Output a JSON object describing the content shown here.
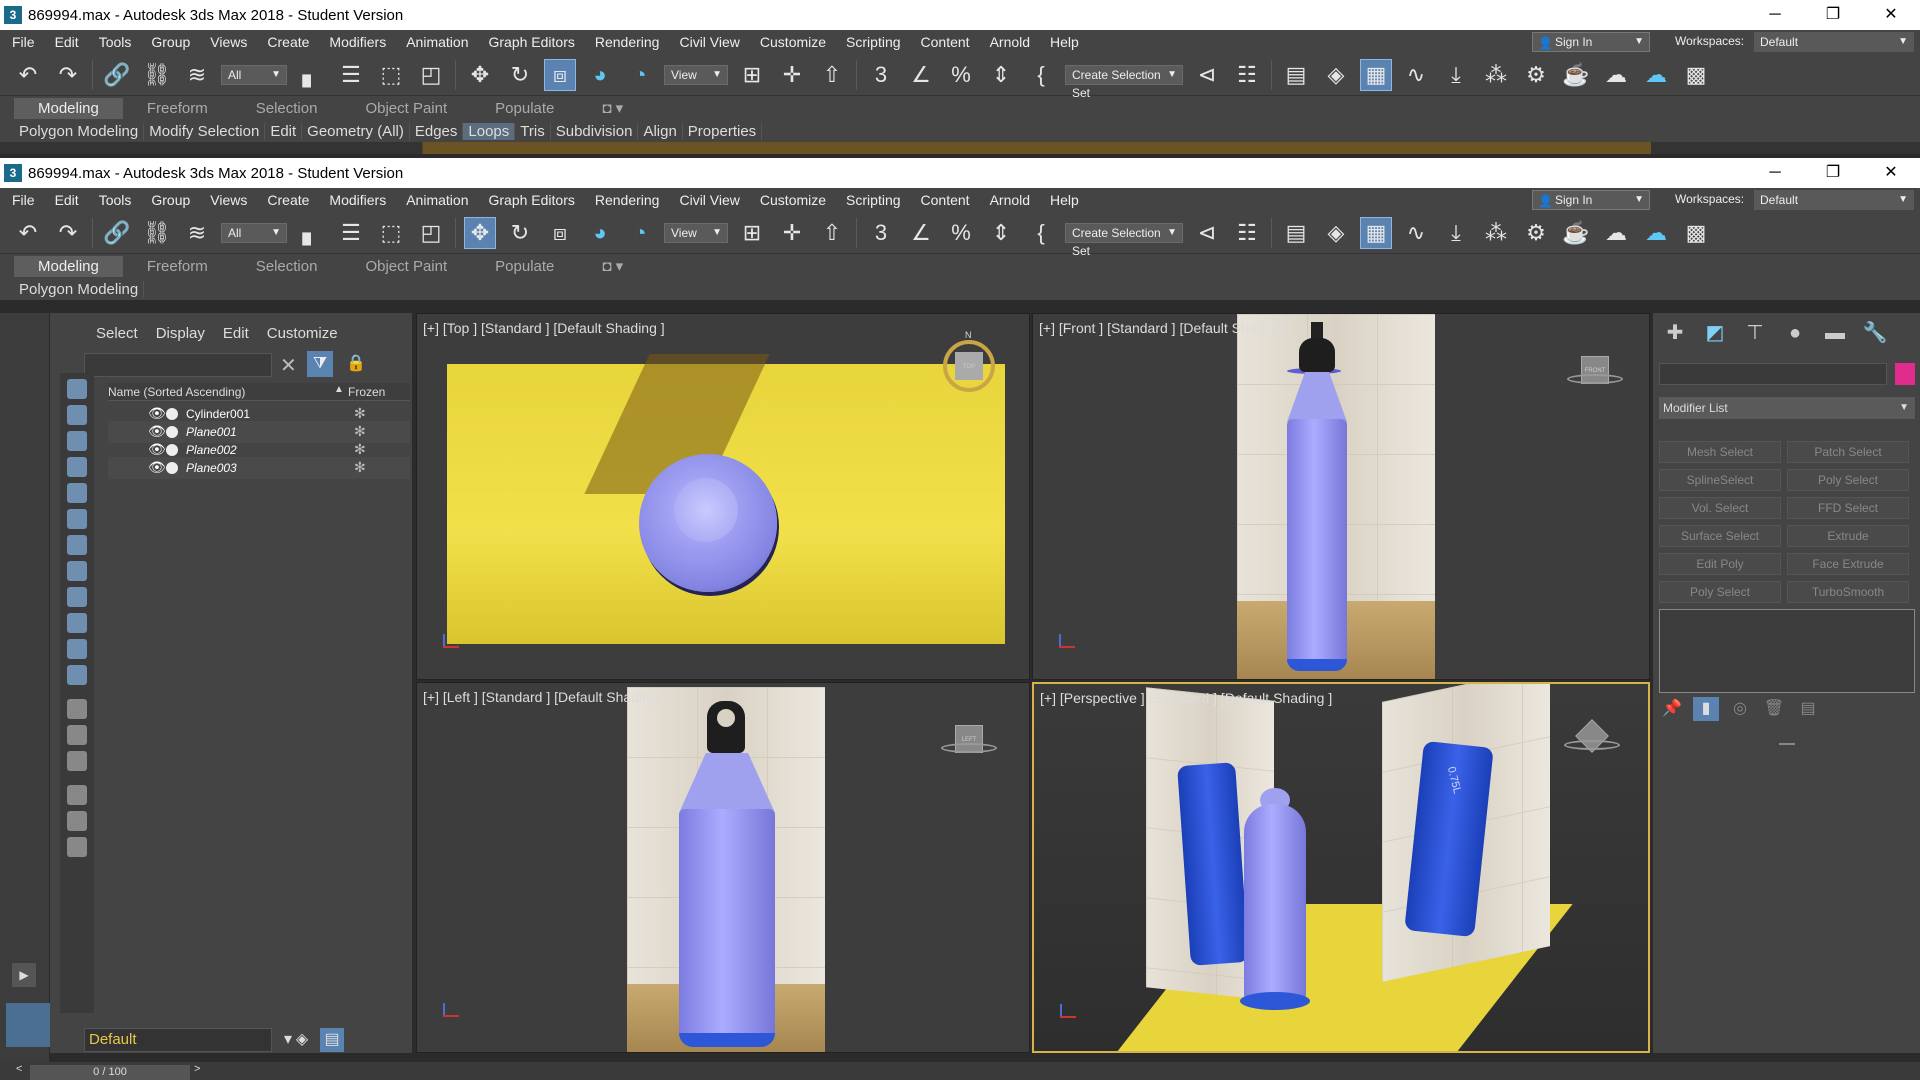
{
  "window_title": "869994.max - Autodesk 3ds Max 2018 - Student Version",
  "menu": [
    "File",
    "Edit",
    "Tools",
    "Group",
    "Views",
    "Create",
    "Modifiers",
    "Animation",
    "Graph Editors",
    "Rendering",
    "Civil View",
    "Customize",
    "Scripting",
    "Content",
    "Arnold",
    "Help"
  ],
  "account": {
    "sign_in": "Sign In",
    "workspaces_label": "Workspaces:",
    "workspace": "Default"
  },
  "toolbar": {
    "filter": "All",
    "ref_coord": "View",
    "selection_set": "Create Selection Set"
  },
  "ribbon": {
    "tabs": [
      "Modeling",
      "Freeform",
      "Selection",
      "Object Paint",
      "Populate"
    ],
    "back_row": [
      "Polygon Modeling",
      "Modify Selection",
      "Edit",
      "Geometry (All)",
      "Edges",
      "Loops",
      "Tris",
      "Subdivision",
      "Align",
      "Properties"
    ],
    "front_row": "Polygon Modeling"
  },
  "scene_explorer": {
    "tabs": [
      "Select",
      "Display",
      "Edit",
      "Customize"
    ],
    "col_name": "Name (Sorted Ascending)",
    "col_frozen": "Frozen",
    "rows": [
      "Cylinder001",
      "Plane001",
      "Plane002",
      "Plane003"
    ],
    "layer": "Default"
  },
  "viewports": {
    "top": "[+] [Top ] [Standard ] [Default Shading ]",
    "front": "[+] [Front ] [Standard ] [Default Shading ]",
    "left": "[+] [Left ] [Standard ] [Default Shading ]",
    "persp": "[+] [Perspective ] [Standard ] [Default Shading ]"
  },
  "viewcube_labels": {
    "top": "TOP",
    "front": "FRONT",
    "left": "LEFT",
    "north": "N"
  },
  "bottle_label": "0.75L",
  "command_panel": {
    "modifier_list": "Modifier List",
    "buttons": [
      "Mesh Select",
      "Patch Select",
      "SplineSelect",
      "Poly Select",
      "Vol. Select",
      "FFD Select",
      "Surface Select",
      "Extrude",
      "Edit Poly",
      "Face Extrude",
      "Poly Select",
      "TurboSmooth"
    ]
  },
  "timeline": "0 / 100",
  "colors": {
    "accent": "#5a83b1",
    "active_viewport": "#d8b24a",
    "bottle": "#8e8fe6",
    "floor": "#e8d53c",
    "layer_text": "#e8c84a",
    "object_color": "#e02c8c"
  }
}
